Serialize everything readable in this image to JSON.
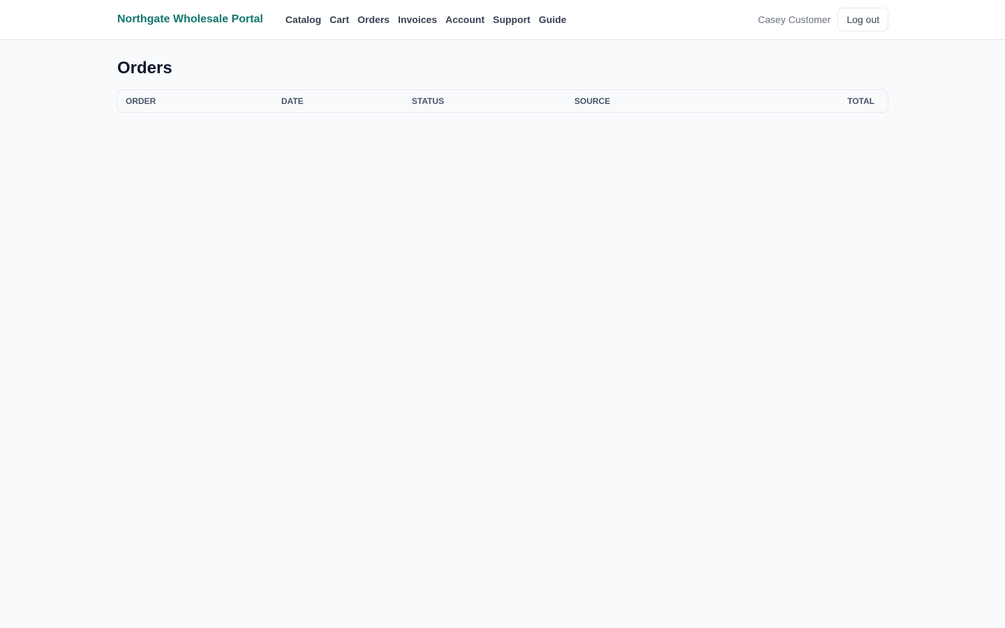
{
  "header": {
    "brand": "Northgate Wholesale Portal",
    "nav": [
      {
        "label": "Catalog"
      },
      {
        "label": "Cart"
      },
      {
        "label": "Orders"
      },
      {
        "label": "Invoices"
      },
      {
        "label": "Account"
      },
      {
        "label": "Support"
      },
      {
        "label": "Guide"
      }
    ],
    "user_name": "Casey Customer",
    "logout_label": "Log out"
  },
  "main": {
    "title": "Orders",
    "table": {
      "columns": [
        "ORDER",
        "DATE",
        "STATUS",
        "SOURCE",
        "TOTAL"
      ],
      "rows": []
    }
  },
  "colors": {
    "brand": "#0f766e",
    "background": "#f8fafc"
  }
}
